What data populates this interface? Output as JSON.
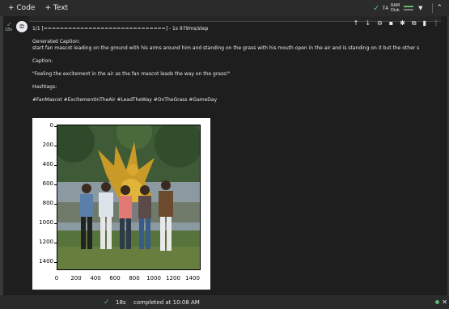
{
  "toolbar": {
    "code_label": "+ Code",
    "text_label": "+ Text"
  },
  "runtime": {
    "check": "✓",
    "accelerator": "T4",
    "ram_label": "RAM",
    "disk_label": "Disk"
  },
  "cell": {
    "exec_time": "18s",
    "output_lines": [
      "1/1 [==============================] - 1s 979ms/step",
      "",
      "Generated Caption:",
      "start fan mascot leading on the ground with his arms around him and standing on the grass with his mouth open in the air and is standing on it but the other s",
      "",
      "Caption:",
      "",
      "\"Feeling the excitement in the air as the fan mascot leads the way on the grass!\"",
      "",
      "Hashtags:",
      "",
      "#FanMascot #ExcitementInTheAir #LeadTheWay #OnTheGrass #GameDay"
    ]
  },
  "plot": {
    "y_ticks": [
      "0",
      "200",
      "400",
      "600",
      "800",
      "1000",
      "1200",
      "1400"
    ],
    "x_ticks": [
      "0",
      "200",
      "400",
      "600",
      "800",
      "1000",
      "1200",
      "1400"
    ],
    "image_width": 1500,
    "image_height": 1500
  },
  "status": {
    "check": "✓",
    "time": "18s",
    "text": "completed at 10:08 AM"
  }
}
